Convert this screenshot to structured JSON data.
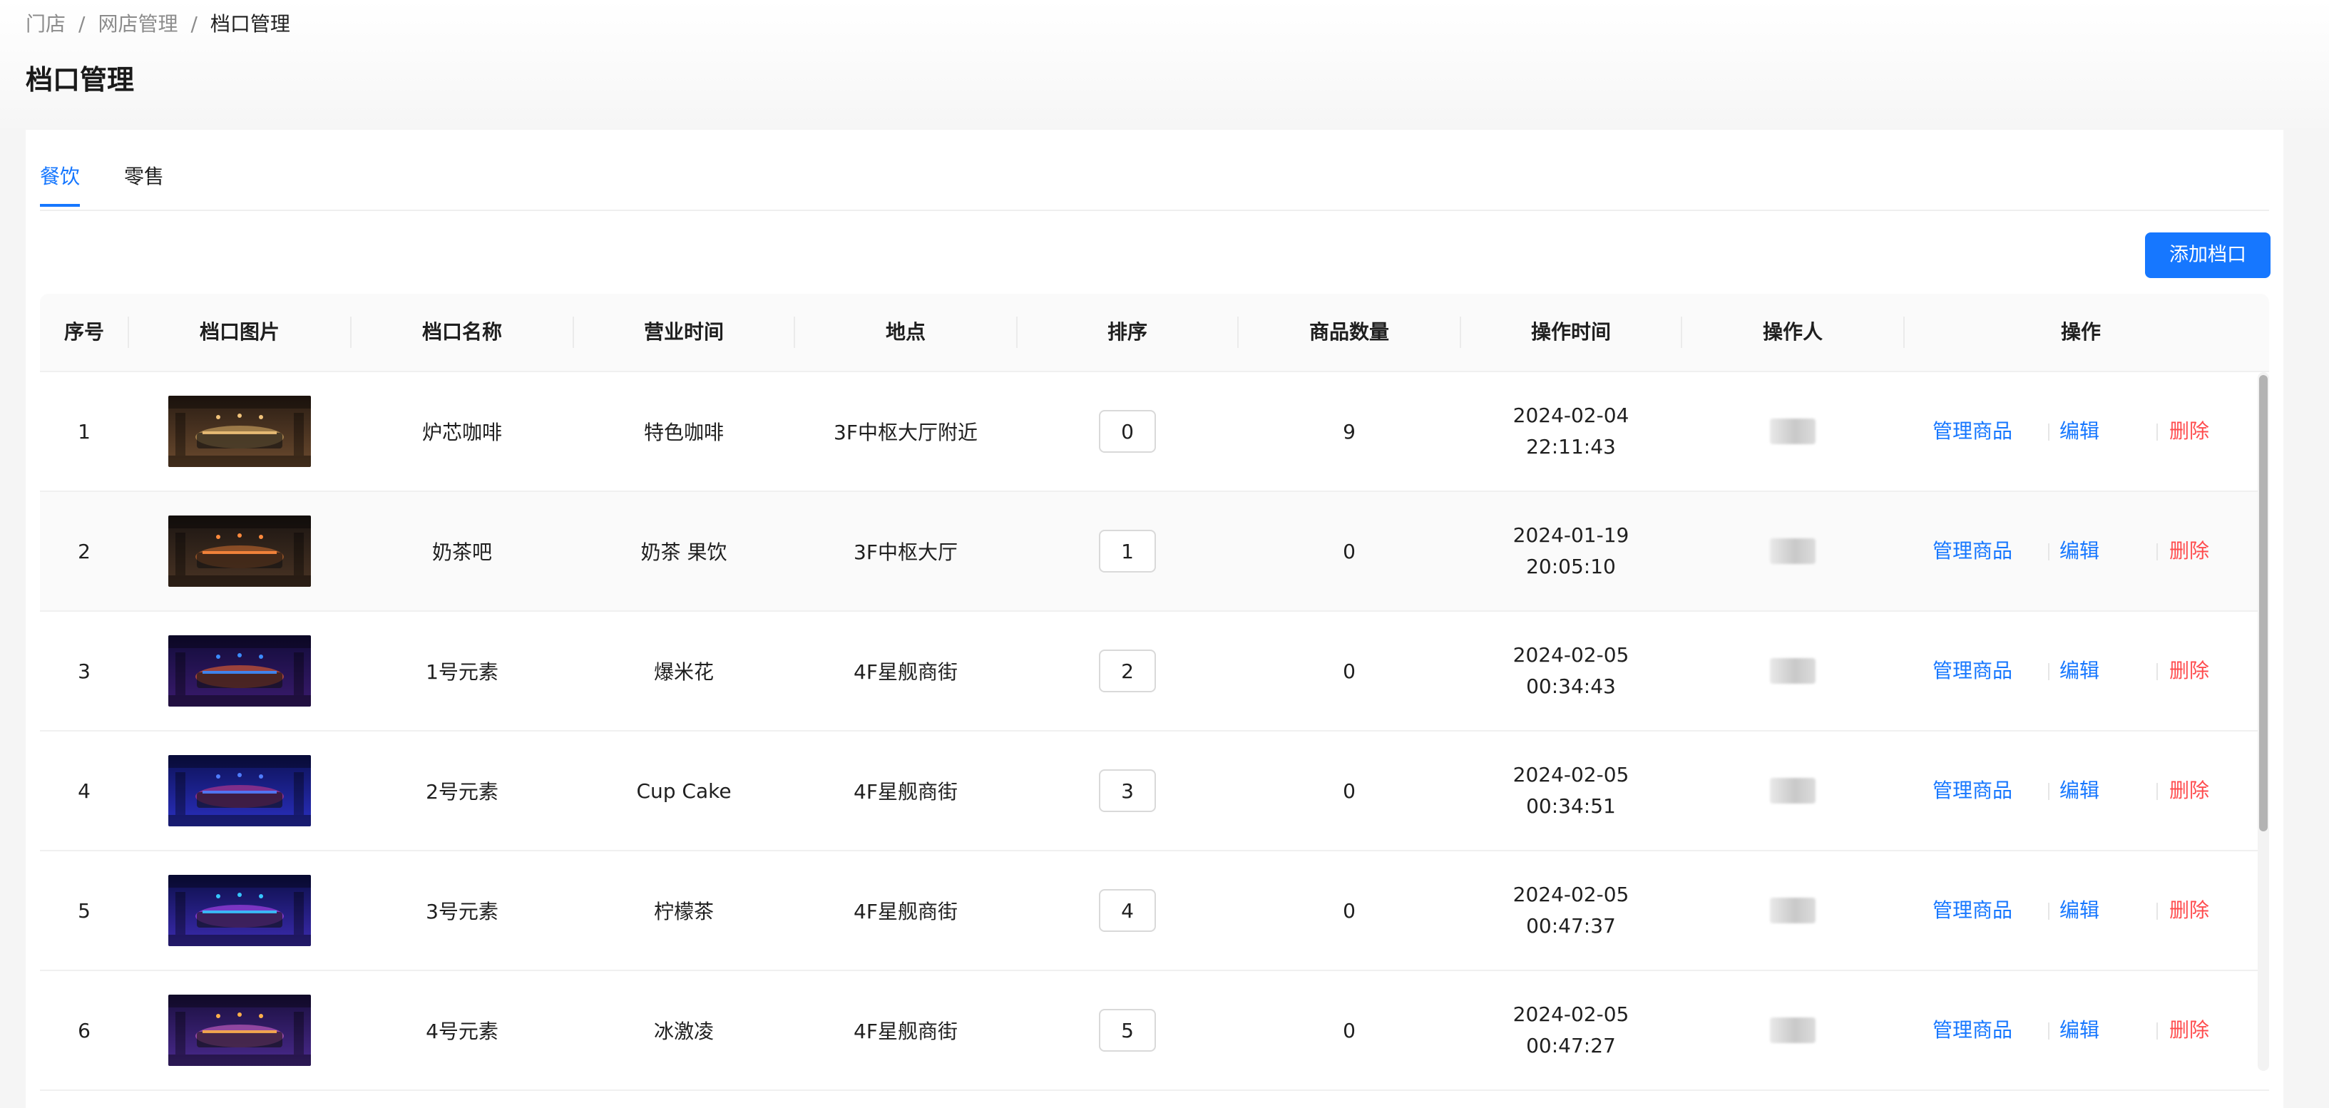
{
  "breadcrumb": [
    "门店",
    "网店管理",
    "档口管理"
  ],
  "page_title": "档口管理",
  "tabs": [
    {
      "label": "餐饮",
      "active": true
    },
    {
      "label": "零售",
      "active": false
    }
  ],
  "add_button": "添加档口",
  "table": {
    "headers": [
      "序号",
      "档口图片",
      "档口名称",
      "营业时间",
      "地点",
      "排序",
      "商品数量",
      "操作时间",
      "操作人",
      "操作"
    ],
    "actions": {
      "manage": "管理商品",
      "edit": "编辑",
      "delete": "删除"
    },
    "rows": [
      {
        "index": "1",
        "name": "炉芯咖啡",
        "hours": "特色咖啡",
        "location": "3F中枢大厅附近",
        "sort": "0",
        "count": "9",
        "date": "2024-02-04",
        "time": "22:11:43"
      },
      {
        "index": "2",
        "name": "奶茶吧",
        "hours": "奶茶 果饮",
        "location": "3F中枢大厅",
        "sort": "1",
        "count": "0",
        "date": "2024-01-19",
        "time": "20:05:10"
      },
      {
        "index": "3",
        "name": "1号元素",
        "hours": "爆米花",
        "location": "4F星舰商街",
        "sort": "2",
        "count": "0",
        "date": "2024-02-05",
        "time": "00:34:43"
      },
      {
        "index": "4",
        "name": "2号元素",
        "hours": "Cup Cake",
        "location": "4F星舰商街",
        "sort": "3",
        "count": "0",
        "date": "2024-02-05",
        "time": "00:34:51"
      },
      {
        "index": "5",
        "name": "3号元素",
        "hours": "柠檬茶",
        "location": "4F星舰商街",
        "sort": "4",
        "count": "0",
        "date": "2024-02-05",
        "time": "00:47:37"
      },
      {
        "index": "6",
        "name": "4号元素",
        "hours": "冰激凌",
        "location": "4F星舰商街",
        "sort": "5",
        "count": "0",
        "date": "2024-02-05",
        "time": "00:47:27"
      }
    ]
  },
  "colors": {
    "primary": "#1677ff",
    "danger": "#ff4d4f",
    "header_bg": "#fafafa"
  }
}
